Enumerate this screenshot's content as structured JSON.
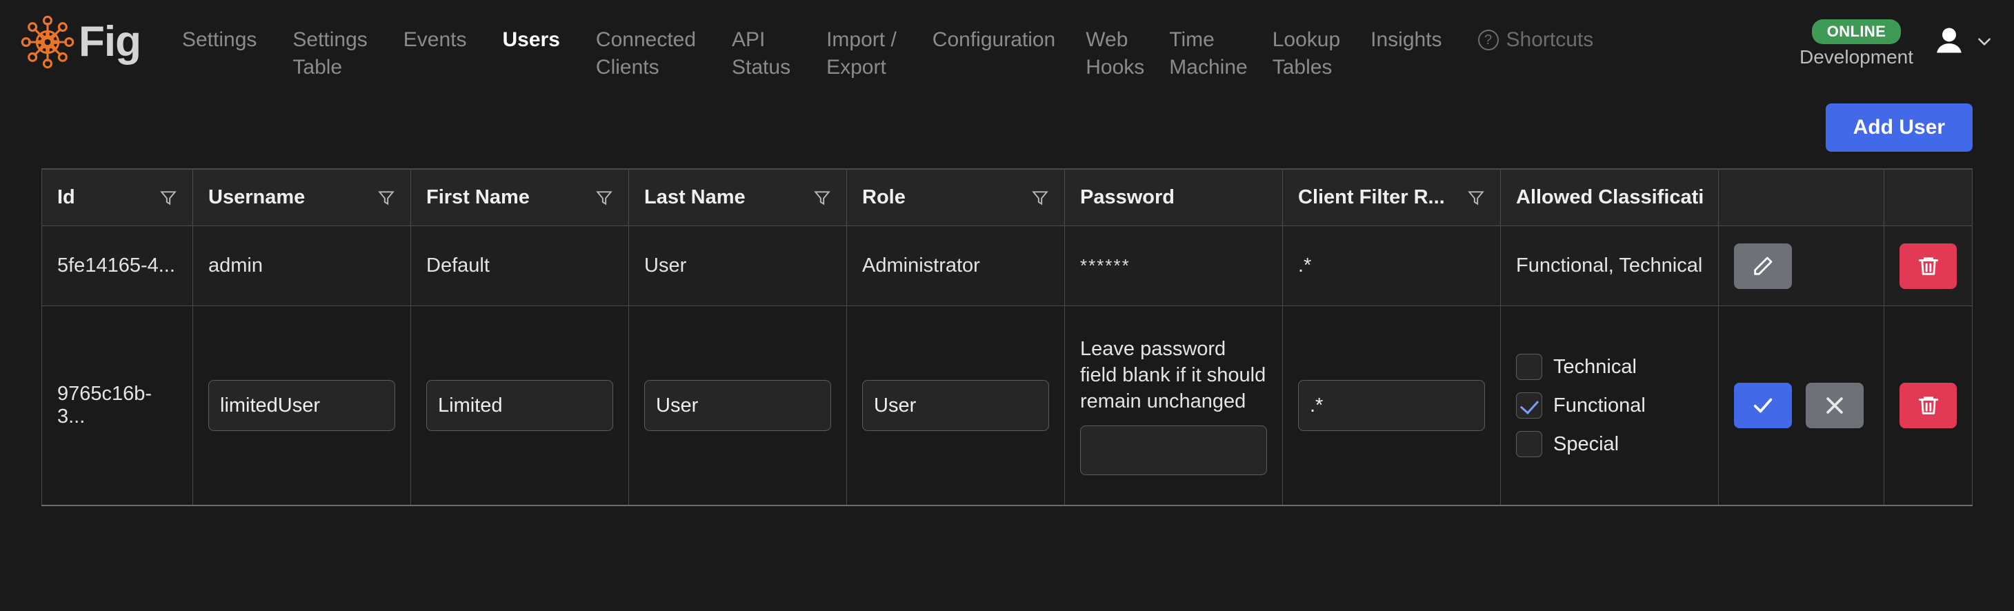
{
  "brand": {
    "name": "Fig",
    "logo_icon": "fig-atom-gear-logo"
  },
  "nav": {
    "items": [
      {
        "label": "Settings",
        "active": false,
        "muted": false
      },
      {
        "label": "Settings\nTable",
        "active": false,
        "muted": false
      },
      {
        "label": "Events",
        "active": false,
        "muted": false
      },
      {
        "label": "Users",
        "active": true,
        "muted": false
      },
      {
        "label": "Connected\nClients",
        "active": false,
        "muted": false
      },
      {
        "label": "API\nStatus",
        "active": false,
        "muted": false
      },
      {
        "label": "Import /\nExport",
        "active": false,
        "muted": false
      },
      {
        "label": "Configuration",
        "active": false,
        "muted": false
      },
      {
        "label": "Web\nHooks",
        "active": false,
        "muted": false
      },
      {
        "label": "Time\nMachine",
        "active": false,
        "muted": false
      },
      {
        "label": "Lookup\nTables",
        "active": false,
        "muted": false
      },
      {
        "label": "Insights",
        "active": false,
        "muted": false
      }
    ],
    "shortcuts": {
      "label": "Shortcuts",
      "icon": "question-circle-icon",
      "glyph": "?"
    }
  },
  "header_right": {
    "status_badge": "ONLINE",
    "status_color": "#3f9a55",
    "environment": "Development",
    "avatar_icon": "user-avatar-icon",
    "chevron_icon": "chevron-down-icon"
  },
  "toolbar": {
    "add_user_label": "Add User",
    "accent_color": "#4169e8"
  },
  "table": {
    "columns": [
      {
        "key": "id",
        "label": "Id",
        "filterable": true
      },
      {
        "key": "user",
        "label": "Username",
        "filterable": true
      },
      {
        "key": "first",
        "label": "First Name",
        "filterable": true
      },
      {
        "key": "last",
        "label": "Last Name",
        "filterable": true
      },
      {
        "key": "role",
        "label": "Role",
        "filterable": true
      },
      {
        "key": "pass",
        "label": "Password",
        "filterable": false
      },
      {
        "key": "filt",
        "label": "Client Filter R...",
        "filterable": true
      },
      {
        "key": "class",
        "label": "Allowed Classificati...",
        "filterable": false
      }
    ],
    "rows": [
      {
        "mode": "view",
        "id": "5fe14165-4...",
        "username": "admin",
        "first_name": "Default",
        "last_name": "User",
        "role": "Administrator",
        "password": "******",
        "client_filter": ".*",
        "allowed_classifications": "Functional, Technical",
        "edit_icon": "pencil-icon",
        "delete_icon": "trash-icon"
      },
      {
        "mode": "edit",
        "id": "9765c16b-3...",
        "username": "limitedUser",
        "first_name": "Limited",
        "last_name": "User",
        "role": "User",
        "password_hint": "Leave password field blank if it should remain unchanged",
        "password_value": "",
        "client_filter": ".*",
        "classification_options": [
          {
            "label": "Technical",
            "checked": false
          },
          {
            "label": "Functional",
            "checked": true
          },
          {
            "label": "Special",
            "checked": false
          }
        ],
        "confirm_icon": "check-icon",
        "cancel_icon": "close-x-icon",
        "delete_icon": "trash-icon"
      }
    ]
  }
}
